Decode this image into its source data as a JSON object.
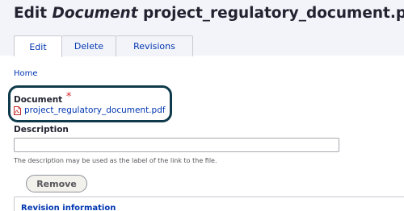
{
  "header": {
    "title_prefix": "Edit",
    "title_type": "Document",
    "title_name": "project_regulatory_document.pdf",
    "star_icon": "☆"
  },
  "tabs": [
    {
      "label": "Edit",
      "active": true
    },
    {
      "label": "Delete",
      "active": false
    },
    {
      "label": "Revisions",
      "active": false
    }
  ],
  "breadcrumb": {
    "home": "Home"
  },
  "document_field": {
    "label": "Document",
    "required_marker": "*",
    "file_icon": "pdf-file-icon",
    "file_name": "project_regulatory_document.pdf"
  },
  "description_field": {
    "label": "Description",
    "value": "",
    "help": "The description may be used as the label of the link to the file."
  },
  "actions": {
    "remove_label": "Remove"
  },
  "revision": {
    "title": "Revision information"
  },
  "colors": {
    "link": "#0036b1",
    "highlight_border": "#0e3a4c",
    "required": "#d72222",
    "header_bg": "#f3f4f9"
  }
}
